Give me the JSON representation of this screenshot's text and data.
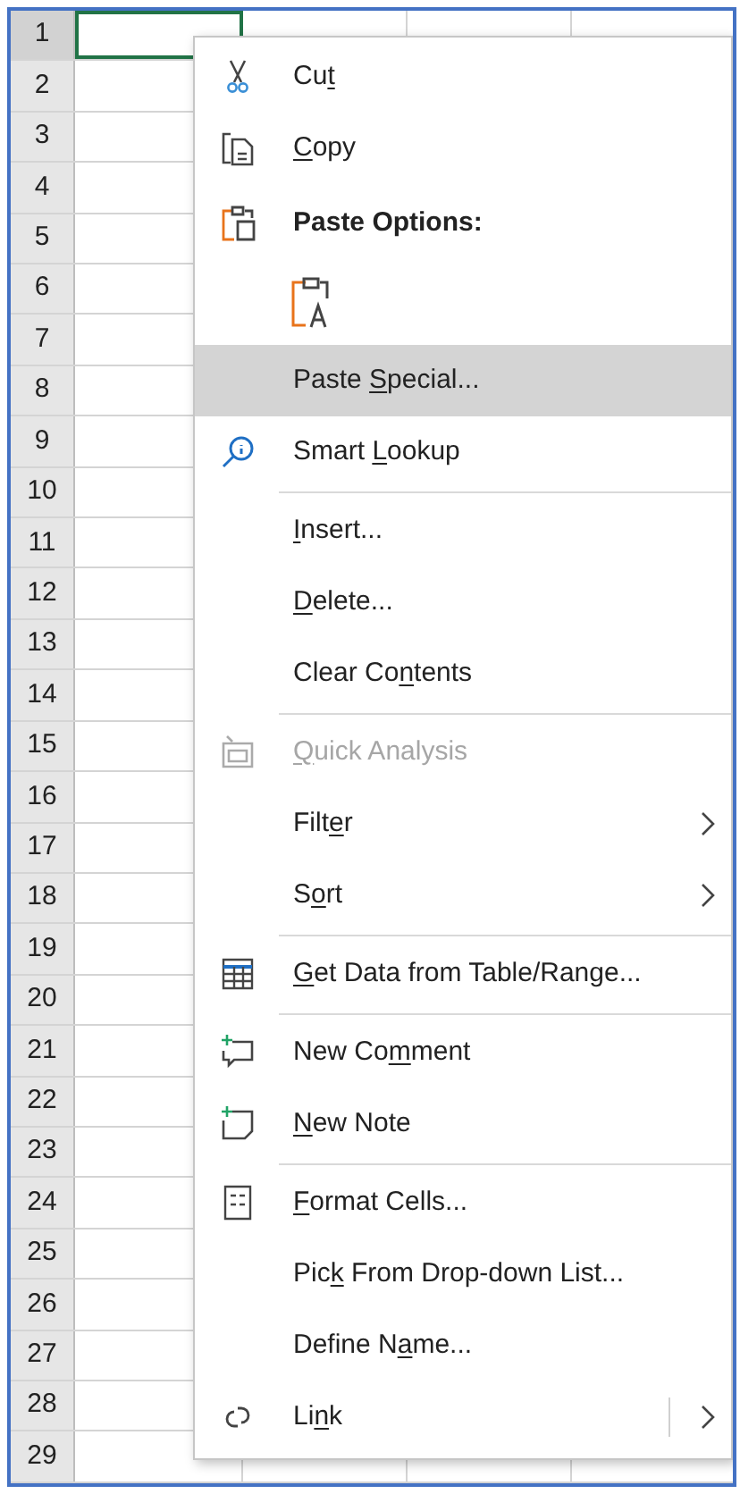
{
  "sheet": {
    "rows": [
      {
        "number": "1",
        "selected": true
      },
      {
        "number": "2",
        "selected": false
      },
      {
        "number": "3",
        "selected": false
      },
      {
        "number": "4",
        "selected": false
      },
      {
        "number": "5",
        "selected": false
      },
      {
        "number": "6",
        "selected": false
      },
      {
        "number": "7",
        "selected": false
      },
      {
        "number": "8",
        "selected": false
      },
      {
        "number": "9",
        "selected": false
      },
      {
        "number": "10",
        "selected": false
      },
      {
        "number": "11",
        "selected": false
      },
      {
        "number": "12",
        "selected": false
      },
      {
        "number": "13",
        "selected": false
      },
      {
        "number": "14",
        "selected": false
      },
      {
        "number": "15",
        "selected": false
      },
      {
        "number": "16",
        "selected": false
      },
      {
        "number": "17",
        "selected": false
      },
      {
        "number": "18",
        "selected": false
      },
      {
        "number": "19",
        "selected": false
      },
      {
        "number": "20",
        "selected": false
      },
      {
        "number": "21",
        "selected": false
      },
      {
        "number": "22",
        "selected": false
      },
      {
        "number": "23",
        "selected": false
      },
      {
        "number": "24",
        "selected": false
      },
      {
        "number": "25",
        "selected": false
      },
      {
        "number": "26",
        "selected": false
      },
      {
        "number": "27",
        "selected": false
      },
      {
        "number": "28",
        "selected": false
      },
      {
        "number": "29",
        "selected": false
      }
    ]
  },
  "context_menu": {
    "items": [
      {
        "kind": "item",
        "text": "Cu",
        "key": "t",
        "highlighted": false,
        "disabled": false,
        "submenu": false
      },
      {
        "kind": "item",
        "key": "C",
        "rest": "opy",
        "highlighted": false,
        "disabled": false,
        "submenu": false
      },
      {
        "kind": "heading",
        "label": "Paste Options:"
      },
      {
        "kind": "paste_options"
      },
      {
        "kind": "item",
        "text": "Paste ",
        "key": "S",
        "rest": "pecial...",
        "highlighted": true,
        "disabled": false,
        "submenu": false
      },
      {
        "kind": "item",
        "text": "Smart ",
        "key": "L",
        "rest": "ookup",
        "highlighted": false,
        "disabled": false,
        "submenu": false
      },
      {
        "kind": "separator"
      },
      {
        "kind": "item",
        "key": "I",
        "rest": "nsert...",
        "highlighted": false,
        "disabled": false,
        "submenu": false
      },
      {
        "kind": "item",
        "key": "D",
        "rest": "elete...",
        "highlighted": false,
        "disabled": false,
        "submenu": false
      },
      {
        "kind": "item",
        "text": "Clear Co",
        "key": "n",
        "rest": "tents",
        "highlighted": false,
        "disabled": false,
        "submenu": false
      },
      {
        "kind": "separator"
      },
      {
        "kind": "item",
        "key": "Q",
        "rest": "uick Analysis",
        "highlighted": false,
        "disabled": true,
        "submenu": false
      },
      {
        "kind": "item",
        "text": "Filt",
        "key": "e",
        "rest": "r",
        "highlighted": false,
        "disabled": false,
        "submenu": true
      },
      {
        "kind": "item",
        "text": "S",
        "key": "o",
        "rest": "rt",
        "highlighted": false,
        "disabled": false,
        "submenu": true
      },
      {
        "kind": "separator"
      },
      {
        "kind": "item",
        "key": "G",
        "rest": "et Data from Table/Range...",
        "highlighted": false,
        "disabled": false,
        "submenu": false
      },
      {
        "kind": "separator"
      },
      {
        "kind": "item",
        "text": "New Co",
        "key": "m",
        "rest": "ment",
        "highlighted": false,
        "disabled": false,
        "submenu": false
      },
      {
        "kind": "item",
        "key": "N",
        "rest": "ew Note",
        "highlighted": false,
        "disabled": false,
        "submenu": false
      },
      {
        "kind": "separator"
      },
      {
        "kind": "item",
        "key": "F",
        "rest": "ormat Cells...",
        "highlighted": false,
        "disabled": false,
        "submenu": false
      },
      {
        "kind": "item",
        "text": "Pic",
        "key": "k",
        "rest": " From Drop-down List...",
        "highlighted": false,
        "disabled": false,
        "submenu": false
      },
      {
        "kind": "item",
        "text": "Define N",
        "key": "a",
        "rest": "me...",
        "highlighted": false,
        "disabled": false,
        "submenu": false
      },
      {
        "kind": "item",
        "text": "Li",
        "key": "n",
        "rest": "k",
        "highlighted": false,
        "disabled": false,
        "submenu": true,
        "split": true
      }
    ]
  }
}
